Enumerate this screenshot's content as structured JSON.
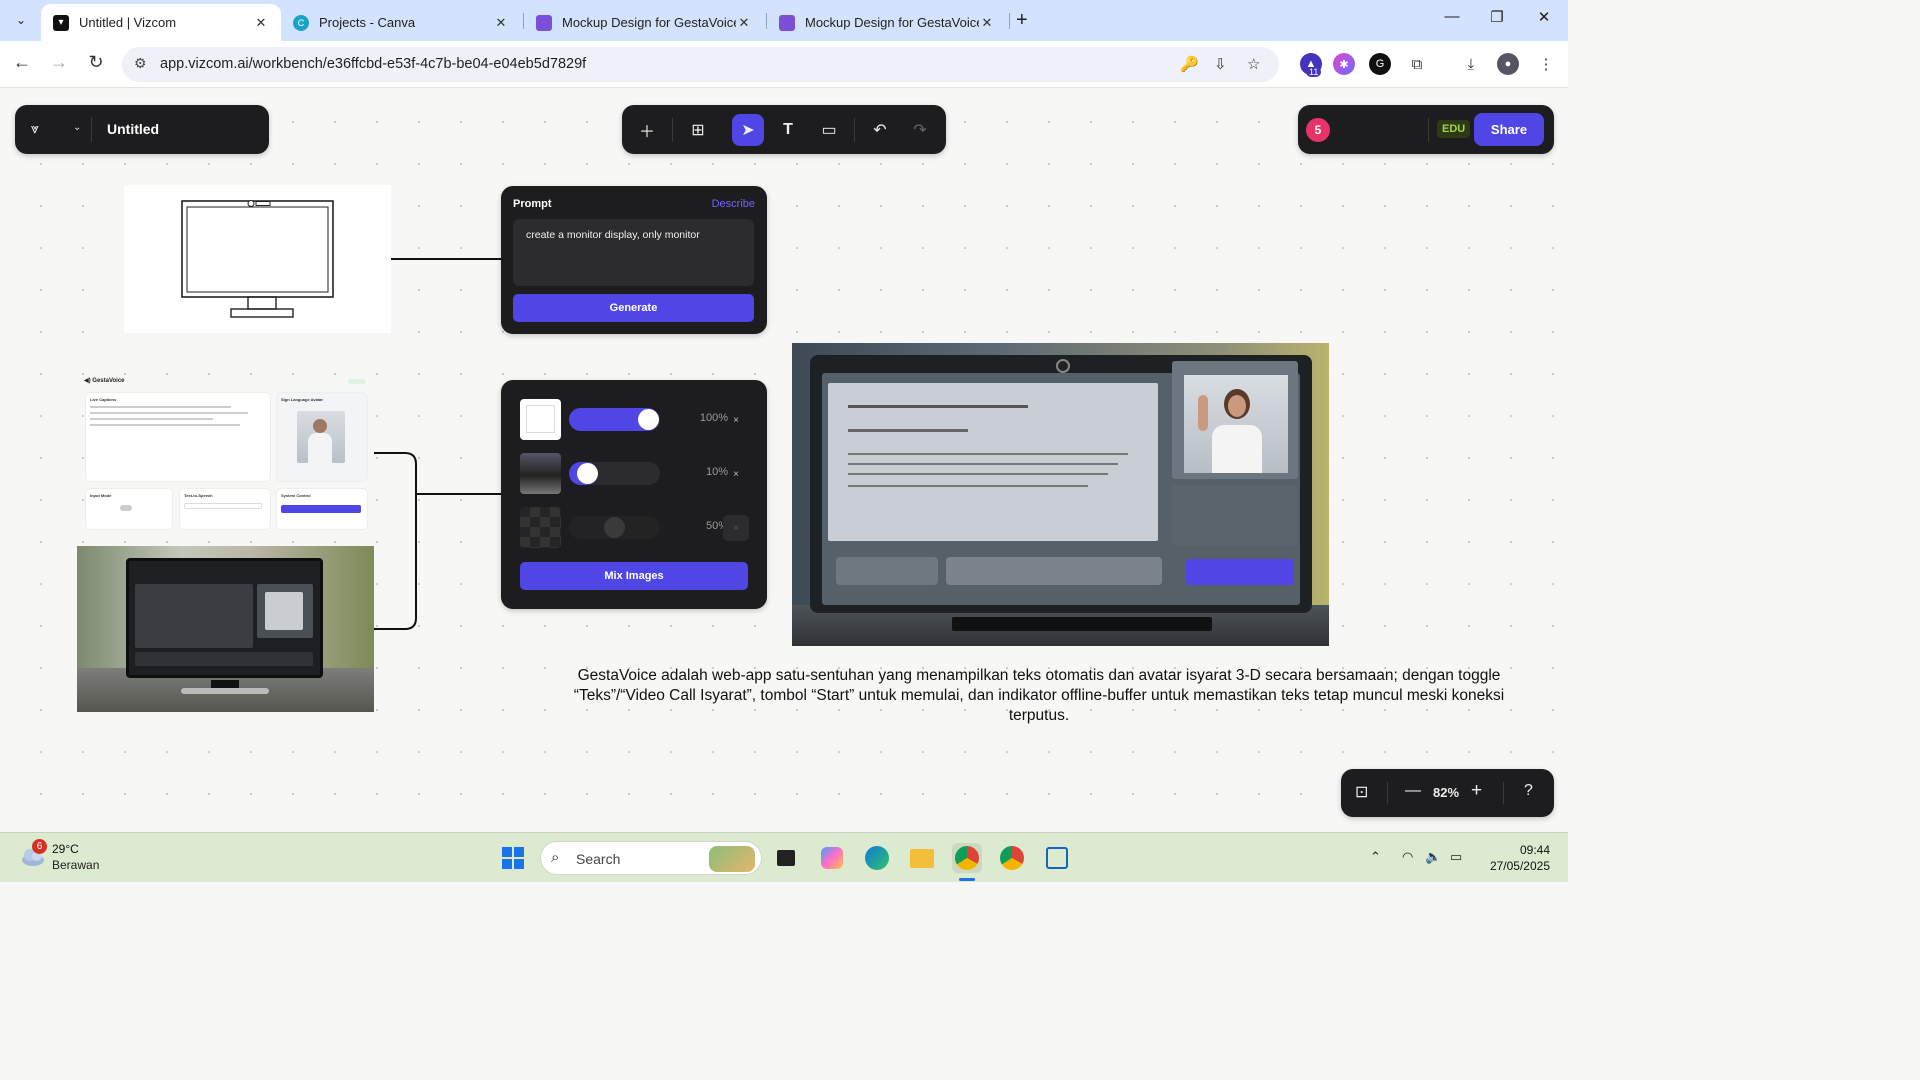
{
  "browser": {
    "tabs": [
      {
        "title": "Untitled | Vizcom",
        "active": true,
        "favicon": "vizcom-icon"
      },
      {
        "title": "Projects - Canva",
        "active": false,
        "favicon": "canva-icon"
      },
      {
        "title": "Mockup Design for GestaVoice",
        "active": false,
        "favicon": "google-slides-icon"
      },
      {
        "title": "Mockup Design for GestaVoice",
        "active": false,
        "favicon": "google-slides-icon"
      }
    ],
    "url": "app.vizcom.ai/workbench/e36ffcbd-e53f-4c7b-be04-e04eb5d7829f",
    "extension_badge": "11"
  },
  "app": {
    "file_name": "Untitled",
    "user_count": "5",
    "edu_badge": "EDU",
    "share_label": "Share",
    "accent": "#4f46e5",
    "tools": [
      "add-icon",
      "components-icon",
      "select-icon",
      "text-icon",
      "frame-icon",
      "undo-icon",
      "redo-icon"
    ]
  },
  "prompt_node": {
    "label": "Prompt",
    "describe_label": "Describe",
    "text": "create a monitor display, only monitor",
    "generate_label": "Generate"
  },
  "mix_node": {
    "rows": [
      {
        "percent": "100%",
        "value": 1.0,
        "enabled": true
      },
      {
        "percent": "10%",
        "value": 0.1,
        "enabled": true
      },
      {
        "percent": "50%",
        "value": 0.5,
        "enabled": false
      }
    ],
    "remove_label": "×",
    "button_label": "Mix Images"
  },
  "mockup": {
    "brand": "GestaVoice",
    "live_captions": "Live Captions",
    "sign_avatar": "Sign Language Avatar",
    "input_mode": "Input Mode",
    "tts": "Text-to-Speech",
    "system_control": "System Control"
  },
  "caption": "GestaVoice adalah web-app satu-sentuhan yang menampilkan teks otomatis dan avatar isyarat 3-D secara bersamaan; dengan toggle “Teks”/“Video Call Isyarat”, tombol “Start” untuk memulai, dan indikator offline-buffer untuk memastikan teks tetap muncul meski koneksi terputus.",
  "zoom": {
    "level": "82%",
    "help": "?"
  },
  "taskbar": {
    "weather_badge": "6",
    "temperature": "29°C",
    "condition": "Berawan",
    "search_placeholder": "Search",
    "time": "09:44",
    "date": "27/05/2025"
  }
}
